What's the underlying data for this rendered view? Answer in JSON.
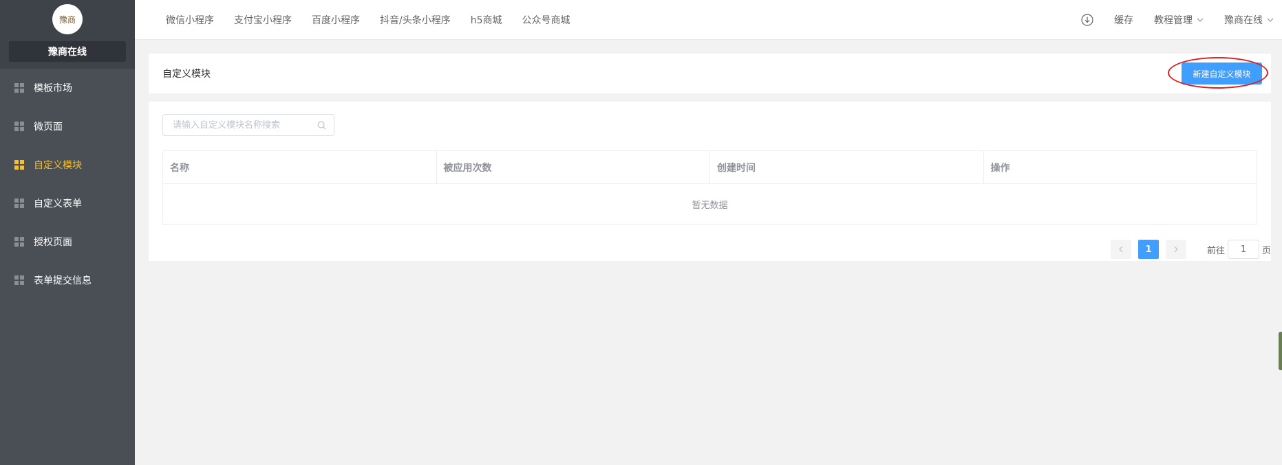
{
  "sidebar": {
    "shop_name": "豫商在线",
    "logo_text": "豫商",
    "items": [
      {
        "label": "模板市场",
        "icon": "grid-icon",
        "active": false
      },
      {
        "label": "微页面",
        "icon": "grid-icon",
        "active": false
      },
      {
        "label": "自定义模块",
        "icon": "grid-icon",
        "active": true
      },
      {
        "label": "自定义表单",
        "icon": "grid-icon",
        "active": false
      },
      {
        "label": "授权页面",
        "icon": "grid-icon",
        "active": false
      },
      {
        "label": "表单提交信息",
        "icon": "grid-icon",
        "active": false
      }
    ]
  },
  "topbar": {
    "nav": [
      "微信小程序",
      "支付宝小程序",
      "百度小程序",
      "抖音/头条小程序",
      "h5商城",
      "公众号商城"
    ],
    "download_icon": "download-icon",
    "cache": "缓存",
    "tutorial": "教程管理",
    "user": "豫商在线"
  },
  "header": {
    "title": "自定义模块",
    "new_button": "新建自定义模块"
  },
  "search": {
    "placeholder": "请输入自定义模块名称搜索"
  },
  "table": {
    "columns": [
      "名称",
      "被应用次数",
      "创建时间",
      "操作"
    ],
    "empty_text": "暂无数据"
  },
  "pagination": {
    "current_page": "1",
    "goto_label": "前往",
    "goto_value": "1",
    "page_suffix": "页"
  },
  "colors": {
    "sidebar_bg": "#4a4f56",
    "active": "#f5c02a",
    "primary": "#409eff",
    "highlight": "#e02020"
  }
}
